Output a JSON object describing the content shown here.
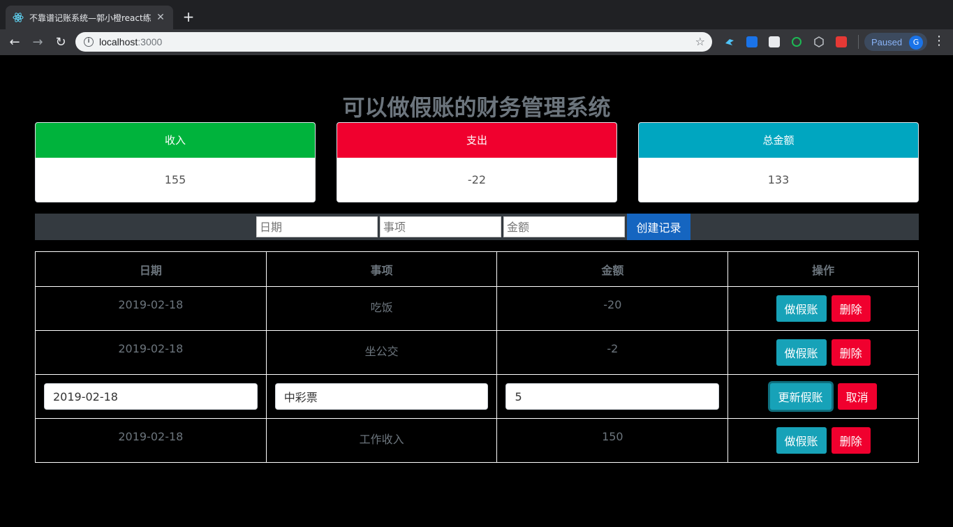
{
  "browser": {
    "tab_title": "不靠谱记账系统—郭小橙react练",
    "url_host": "localhost",
    "url_port": ":3000",
    "profile_status": "Paused",
    "profile_initial": "G"
  },
  "page": {
    "title": "可以做假账的财务管理系统"
  },
  "summary": {
    "income": {
      "label": "收入",
      "value": "155",
      "color": "#00b33c"
    },
    "expense": {
      "label": "支出",
      "value": "-22",
      "color": "#f0002e"
    },
    "total": {
      "label": "总金额",
      "value": "133",
      "color": "#00a6c0"
    }
  },
  "form": {
    "date_placeholder": "日期",
    "item_placeholder": "事项",
    "amount_placeholder": "金额",
    "create_label": "创建记录"
  },
  "table": {
    "headers": [
      "日期",
      "事项",
      "金额",
      "操作"
    ],
    "rows": [
      {
        "date": "2019-02-18",
        "item": "吃饭",
        "amount": "-20",
        "edit_label": "做假账",
        "delete_label": "删除"
      },
      {
        "date": "2019-02-18",
        "item": "坐公交",
        "amount": "-2",
        "edit_label": "做假账",
        "delete_label": "删除"
      },
      {
        "date": "2019-02-18",
        "item": "中彩票",
        "amount": "5",
        "update_label": "更新假账",
        "cancel_label": "取消"
      },
      {
        "date": "2019-02-18",
        "item": "工作收入",
        "amount": "150",
        "edit_label": "做假账",
        "delete_label": "删除"
      }
    ]
  }
}
